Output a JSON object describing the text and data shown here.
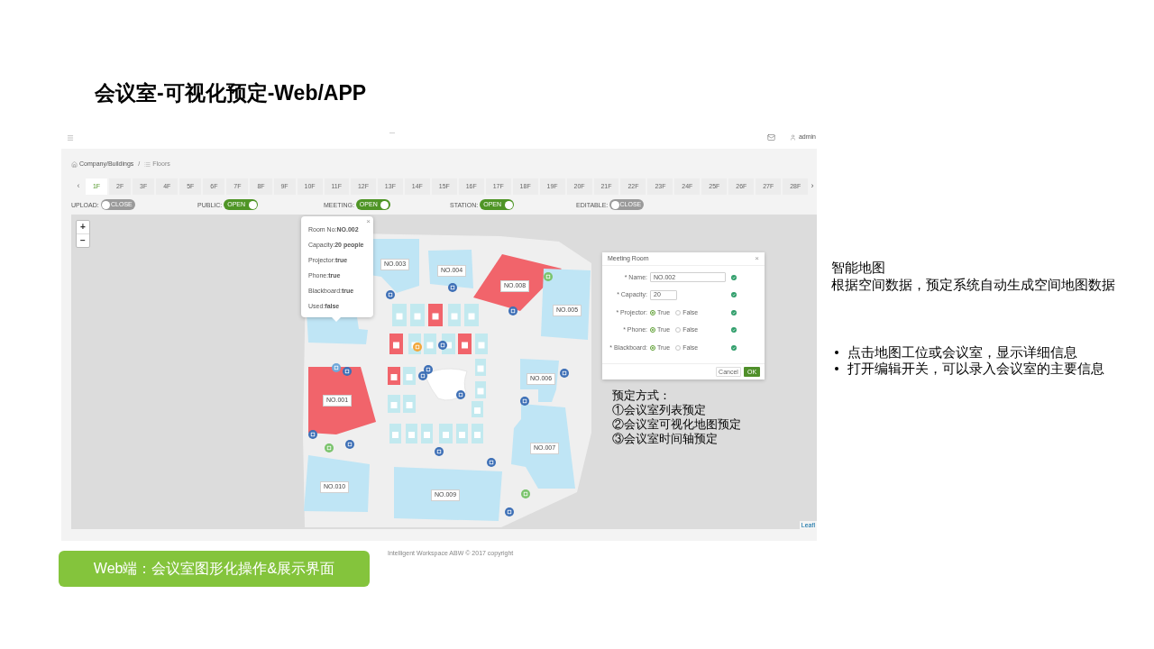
{
  "slide_title": "会议室-可视化预定-Web/APP",
  "app": {
    "user": "admin",
    "breadcrumb": {
      "items": [
        "Company/Buildings",
        "Floors"
      ],
      "separator": "/"
    },
    "floors": {
      "prev": "‹",
      "next": "›",
      "tabs": [
        {
          "label": "1F",
          "selected": true
        },
        {
          "label": "2F",
          "selected": false
        },
        {
          "label": "3F",
          "selected": false
        },
        {
          "label": "4F",
          "selected": false
        },
        {
          "label": "5F",
          "selected": false
        },
        {
          "label": "6F",
          "selected": false
        },
        {
          "label": "7F",
          "selected": false
        },
        {
          "label": "8F",
          "selected": false
        },
        {
          "label": "9F",
          "selected": false
        },
        {
          "label": "10F",
          "selected": false
        },
        {
          "label": "11F",
          "selected": false
        },
        {
          "label": "12F",
          "selected": false
        },
        {
          "label": "13F",
          "selected": false
        },
        {
          "label": "14F",
          "selected": false
        },
        {
          "label": "15F",
          "selected": false
        },
        {
          "label": "16F",
          "selected": false
        },
        {
          "label": "17F",
          "selected": false
        },
        {
          "label": "18F",
          "selected": false
        },
        {
          "label": "19F",
          "selected": false
        },
        {
          "label": "20F",
          "selected": false
        },
        {
          "label": "21F",
          "selected": false
        },
        {
          "label": "22F",
          "selected": false
        },
        {
          "label": "23F",
          "selected": false
        },
        {
          "label": "24F",
          "selected": false
        },
        {
          "label": "25F",
          "selected": false
        },
        {
          "label": "26F",
          "selected": false
        },
        {
          "label": "27F",
          "selected": false
        },
        {
          "label": "28F",
          "selected": false
        }
      ]
    },
    "toggles": [
      {
        "label": "UPLOAD:",
        "on": false,
        "text": "CLOSE"
      },
      {
        "label": "PUBLIC:",
        "on": true,
        "text": "OPEN"
      },
      {
        "label": "MEETING:",
        "on": true,
        "text": "OPEN"
      },
      {
        "label": "STATION:",
        "on": true,
        "text": "OPEN"
      },
      {
        "label": "EDITABLE:",
        "on": false,
        "text": "CLOSE"
      }
    ],
    "map": {
      "zoom_controls": [
        "+",
        "−"
      ],
      "rooms": [
        {
          "label": "NO.003",
          "color": "#bfe5f5"
        },
        {
          "label": "NO.004",
          "color": "#bfe5f5"
        },
        {
          "label": "NO.008",
          "color": "#f1646b"
        },
        {
          "label": "NO.005",
          "color": "#bfe5f5"
        },
        {
          "color": "#bfe5f5"
        },
        {
          "label": "NO.001",
          "color": "#f1646b"
        },
        {
          "label": "NO.006",
          "color": "#bfe5f5"
        },
        {
          "label": "NO.007",
          "color": "#bfe5f5"
        },
        {
          "label": "NO.010",
          "color": "#bfe5f5"
        },
        {
          "label": "NO.009",
          "color": "#bfe5f5"
        }
      ],
      "desks": [
        {
          "color": "#c2e9ef"
        },
        {
          "color": "#c2e9ef"
        },
        {
          "color": "#f1646b"
        },
        {
          "color": "#c2e9ef"
        },
        {
          "color": "#c2e9ef"
        },
        {
          "color": "#f1646b"
        },
        {
          "color": "#c2e9ef"
        },
        {
          "color": "#c2e9ef"
        },
        {
          "color": "#c2e9ef"
        },
        {
          "color": "#f1646b"
        },
        {
          "color": "#c2e9ef"
        },
        {
          "color": "#c2e9ef"
        },
        {
          "color": "#c2e9ef"
        },
        {
          "color": "#c2e9ef"
        },
        {
          "color": "#f1646b"
        },
        {
          "color": "#c2e9ef"
        },
        {
          "color": "#c2e9ef"
        },
        {
          "color": "#c2e9ef"
        },
        {
          "color": "#c2e9ef"
        },
        {
          "color": "#c2e9ef"
        },
        {
          "color": "#c2e9ef"
        },
        {
          "color": "#c2e9ef"
        },
        {
          "color": "#c2e9ef"
        },
        {
          "color": "#c2e9ef"
        }
      ],
      "popup": {
        "close": "×",
        "lines": [
          "Room No:**NO.002**",
          "Capacity:**20 people**",
          "Projector:**true**",
          "Phone:**true**",
          "Blackboard:**true**",
          "Used:**false**"
        ]
      },
      "attribution": "Leafl"
    },
    "dialog": {
      "title": "Meeting Room",
      "close": "×",
      "fields": [
        {
          "kind": "text",
          "label": "* Name:",
          "value": "NO.002",
          "valid": true
        },
        {
          "kind": "number",
          "label": "* Capacity:",
          "value": "20",
          "valid": true
        },
        {
          "kind": "radio",
          "label": "* Projector:",
          "options": [
            {
              "label": "True",
              "selected": true
            },
            {
              "label": "False",
              "selected": false
            }
          ],
          "valid": true
        },
        {
          "kind": "radio",
          "label": "* Phone:",
          "options": [
            {
              "label": "True",
              "selected": true
            },
            {
              "label": "False",
              "selected": false
            }
          ],
          "valid": true
        },
        {
          "kind": "radio",
          "label": "* Blackboard:",
          "options": [
            {
              "label": "True",
              "selected": true
            },
            {
              "label": "False",
              "selected": false
            }
          ],
          "valid": true
        }
      ],
      "buttons": [
        {
          "label": "Cancel",
          "primary": false
        },
        {
          "label": "OK",
          "primary": true
        }
      ]
    },
    "footer": "Intelligent Workspace ABW © 2017 copyright"
  },
  "booking_methods": {
    "title": "预定方式：",
    "items": [
      "①会议室列表预定",
      "②会议室可视化地图预定",
      "③会议室时间轴预定"
    ]
  },
  "notes": {
    "title": "智能地图",
    "description": "根据空间数据，预定系统自动生成空间地图数据",
    "bullets": [
      "点击地图工位或会议室，显示详细信息",
      "打开编辑开关，可以录入会议室的主要信息"
    ]
  },
  "caption": "Web端：会议室图形化操作&展示界面"
}
